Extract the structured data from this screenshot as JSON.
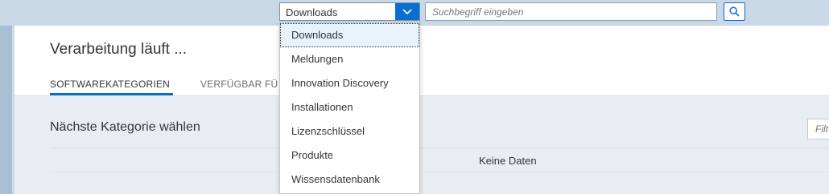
{
  "topbar": {
    "category_select": {
      "value": "Downloads"
    },
    "search": {
      "placeholder": "Suchbegriff eingeben"
    }
  },
  "header": {
    "title": "Verarbeitung läuft ...",
    "tabs": [
      {
        "label": "SOFTWAREKATEGORIEN",
        "selected": true
      },
      {
        "label": "VERFÜGBAR FÜ",
        "selected": false
      }
    ]
  },
  "main": {
    "section_title": "Nächste Kategorie wählen",
    "filter_placeholder": "Filt",
    "empty_text": "Keine Daten"
  },
  "dropdown": {
    "options": [
      {
        "label": "Downloads",
        "selected": true
      },
      {
        "label": "Meldungen"
      },
      {
        "label": "Innovation Discovery"
      },
      {
        "label": "Installationen"
      },
      {
        "label": "Lizenzschlüssel"
      },
      {
        "label": "Produkte"
      },
      {
        "label": "Wissensdatenbank"
      }
    ]
  },
  "colors": {
    "accent": "#0a6ed1",
    "shell": "#c9d8e6",
    "selection": "#e8f2fb"
  }
}
